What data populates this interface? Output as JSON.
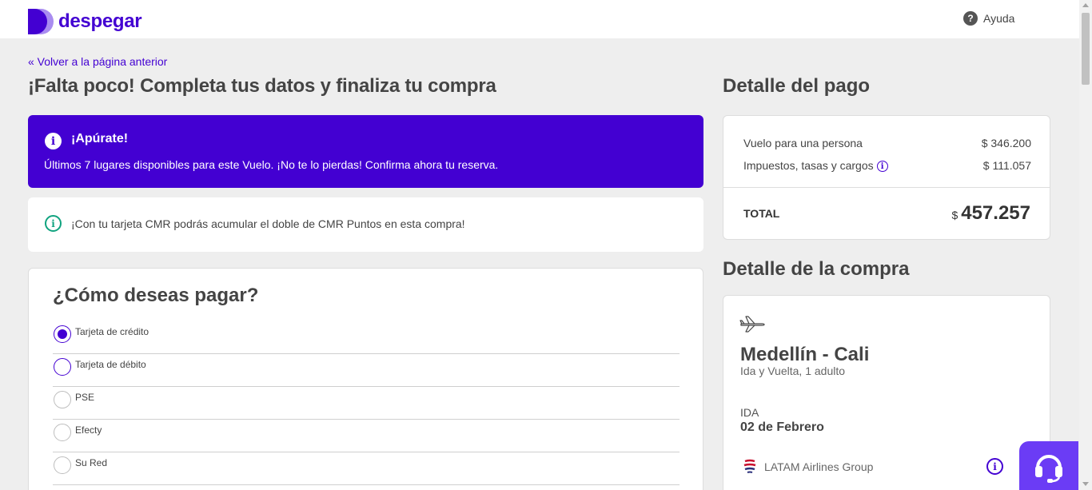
{
  "header": {
    "brand": "despegar",
    "help_label": "Ayuda"
  },
  "back_link": "« Volver a la página anterior",
  "page_title": "¡Falta poco! Completa tus datos y finaliza tu compra",
  "alert": {
    "title": "¡Apúrate!",
    "text": "Últimos 7 lugares disponibles para este Vuelo. ¡No te lo pierdas! Confirma ahora tu reserva."
  },
  "info": {
    "text": "¡Con tu tarjeta CMR podrás acumular el doble de CMR Puntos en esta compra!"
  },
  "payment": {
    "title": "¿Cómo deseas pagar?",
    "options": [
      {
        "label": "Tarjeta de crédito",
        "selected": true
      },
      {
        "label": "Tarjeta de débito",
        "selected": false
      },
      {
        "label": "PSE",
        "selected": false
      },
      {
        "label": "Efecty",
        "selected": false
      },
      {
        "label": "Su Red",
        "selected": false
      }
    ]
  },
  "payment_detail": {
    "title": "Detalle del pago",
    "rows": [
      {
        "label": "Vuelo para una persona",
        "amount": "$ 346.200"
      },
      {
        "label": "Impuestos, tasas y cargos",
        "amount": "$ 111.057"
      }
    ],
    "total_label": "TOTAL",
    "total_currency": "$",
    "total_amount": "457.257"
  },
  "purchase_detail": {
    "title": "Detalle de la compra",
    "route": "Medellín - Cali",
    "trip_type": "Ida y Vuelta, 1 adulto",
    "leg_label": "IDA",
    "leg_date": "02 de Febrero",
    "airline": "LATAM Airlines Group"
  },
  "colors": {
    "brand": "#4300d2",
    "chat_button": "#6b3cf5",
    "info_green": "#10a37f"
  }
}
